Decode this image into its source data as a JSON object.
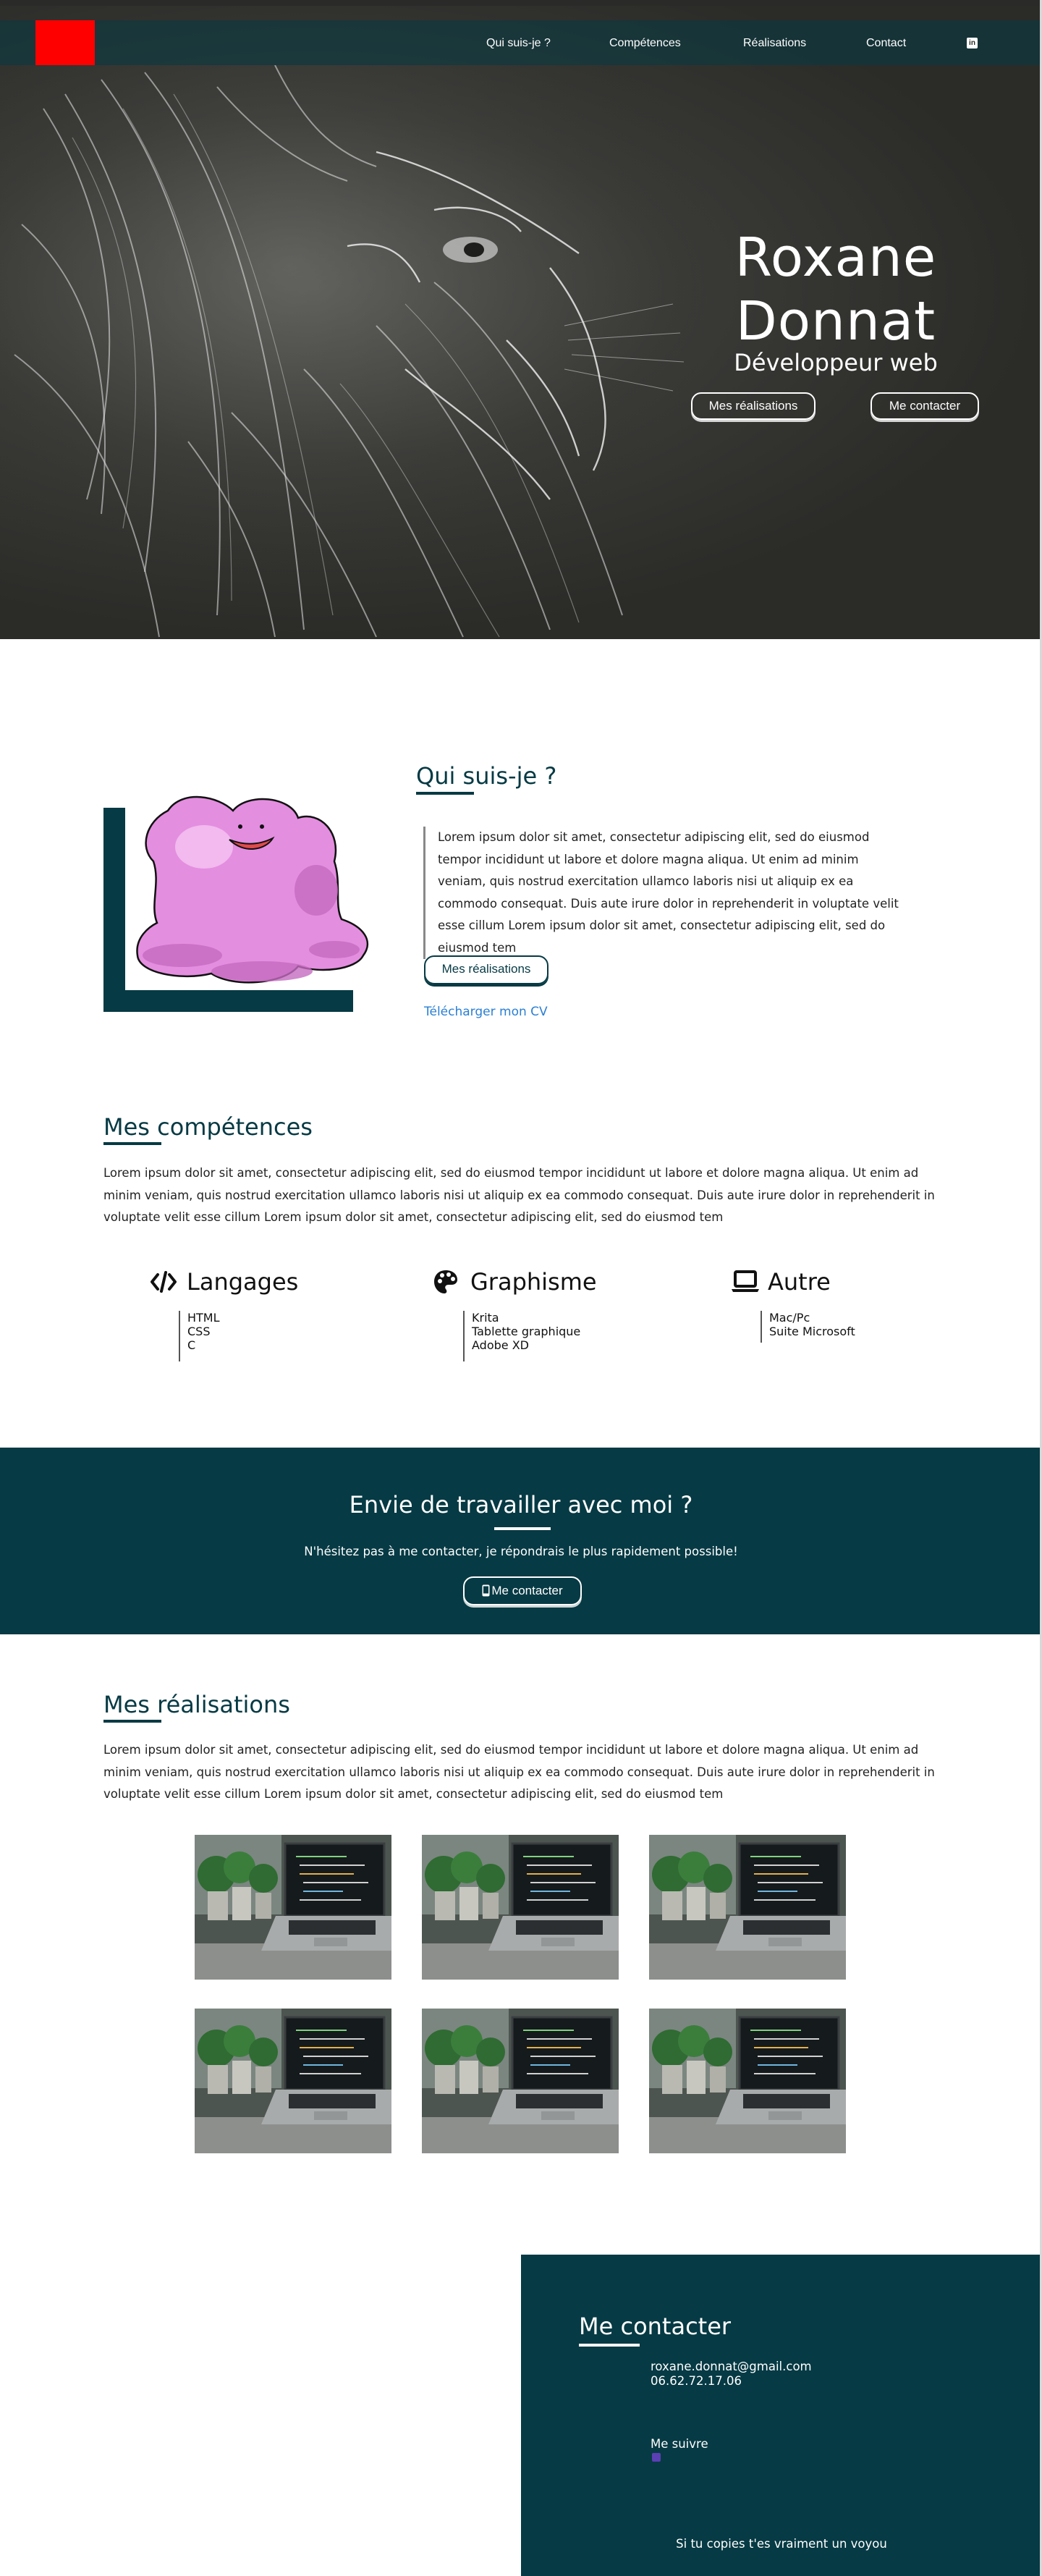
{
  "nav": {
    "links": [
      "Qui suis-je ?",
      "Compétences",
      "Réalisations",
      "Contact"
    ],
    "linkedin_icon": "linkedin-icon",
    "logo_color": "#ff0000"
  },
  "hero": {
    "name_line1": "Roxane",
    "name_line2": "Donnat",
    "subtitle": "Développeur web",
    "btn_works": "Mes réalisations",
    "btn_contact": "Me contacter"
  },
  "about": {
    "title": "Qui suis-je ?",
    "text": "Lorem ipsum dolor sit amet, consectetur adipiscing elit, sed do eiusmod tempor incididunt ut labore et dolore magna aliqua. Ut enim ad minim veniam, quis nostrud exercitation ullamco laboris nisi ut aliquip ex ea commodo consequat. Duis aute irure dolor in reprehenderit in voluptate velit esse cillum Lorem ipsum dolor sit amet, consectetur adipiscing elit, sed do eiusmod tem",
    "btn_works": "Mes réalisations",
    "cv_link": "Télécharger mon CV"
  },
  "skills": {
    "title": "Mes compétences",
    "text": "Lorem ipsum dolor sit amet, consectetur adipiscing elit, sed do eiusmod tempor incididunt ut labore et dolore magna aliqua. Ut enim ad minim veniam, quis nostrud exercitation ullamco laboris nisi ut aliquip ex ea commodo consequat. Duis aute irure dolor in reprehenderit in voluptate velit esse cillum Lorem ipsum dolor sit amet, consectetur adipiscing elit, sed do eiusmod tem",
    "groups": [
      {
        "icon": "code-icon",
        "title": "Langages",
        "items": [
          "HTML",
          "CSS",
          "C"
        ]
      },
      {
        "icon": "palette-icon",
        "title": "Graphisme",
        "items": [
          "Krita",
          "Tablette graphique",
          "Adobe XD"
        ]
      },
      {
        "icon": "laptop-icon",
        "title": "Autre",
        "items": [
          "Mac/Pc",
          "Suite Microsoft"
        ]
      }
    ]
  },
  "cta": {
    "title": "Envie de travailler avec moi ?",
    "text": "N'hésitez pas à me contacter, je répondrais le plus rapidement possible!",
    "button": "Me contacter",
    "button_icon": "mobile-phone-icon"
  },
  "works": {
    "title": "Mes réalisations",
    "text": "Lorem ipsum dolor sit amet, consectetur adipiscing elit, sed do eiusmod tempor incididunt ut labore et dolore magna aliqua. Ut enim ad minim veniam, quis nostrud exercitation ullamco laboris nisi ut aliquip ex ea commodo consequat. Duis aute irure dolor in reprehenderit in voluptate velit esse cillum Lorem ipsum dolor sit amet, consectetur adipiscing elit, sed do eiusmod tem"
  },
  "contact": {
    "title": "Me contacter",
    "email": "roxane.donnat@gmail.com",
    "phone": "06.62.72.17.06",
    "follow": "Me suivre",
    "footer": "Si tu copies t'es vraiment un voyou"
  },
  "colors": {
    "primary": "#063a44",
    "link": "#2a7fd4",
    "accent_logo": "#ff0000"
  }
}
